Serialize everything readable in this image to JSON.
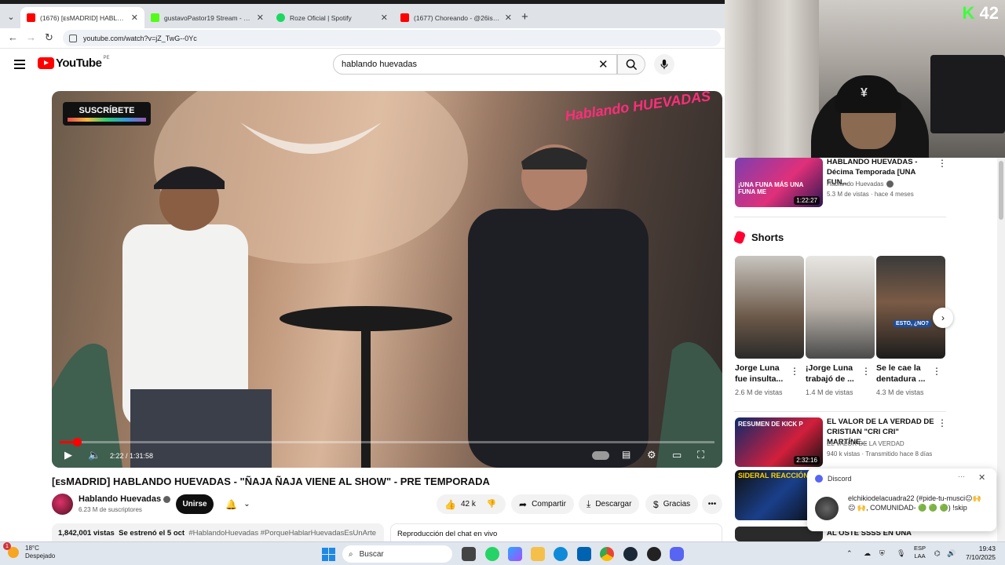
{
  "browser": {
    "tabs": [
      {
        "title": "(1676) [ᴇsMADRID] HABLANDO",
        "favicon_color": "#ff0000",
        "active": true
      },
      {
        "title": "gustavoPastor19 Stream - Watch",
        "favicon_color": "#53fc18",
        "active": false
      },
      {
        "title": "Roze Oficial | Spotify",
        "favicon_color": "#1ed760",
        "active": false
      },
      {
        "title": "(1677) Choreando - @26is , @",
        "favicon_color": "#ff0000",
        "active": false
      }
    ],
    "url": "youtube.com/watch?v=jZ_TwG--0Yc"
  },
  "youtube": {
    "logo_text": "YouTube",
    "country": "PE",
    "search_value": "hablando huevadas"
  },
  "video": {
    "badge_text": "SUSCRÍBETE",
    "show_logo": "Hablando HUEVADAS",
    "time": "2:22 / 1:31:58",
    "progress": 0.026,
    "title": "[ᴇsMADRID] HABLANDO HUEVADAS - \"ÑAJA ÑAJA VIENE AL SHOW\" - PRE TEMPORADA",
    "channel": "Hablando Huevadas",
    "subscribers": "6.23 M de suscriptores",
    "join_label": "Unirse",
    "likes": "42 k",
    "share_label": "Compartir",
    "download_label": "Descargar",
    "thanks_label": "Gracias",
    "views": "1,842,001 vistas",
    "premiered": "Se estrenó el 5 oct",
    "tags": "#HablandoHuevadas #PorqueHablarHuevadasEsUnArte",
    "chat_replay": "Reproducción del chat en vivo"
  },
  "webcam": {
    "overlay": "42"
  },
  "sidebar": {
    "top_video": {
      "title": "HABLANDO HUEVADAS - Décima Temporada [UNA FUN...",
      "channel": "Hablando Huevadas",
      "meta": "5.3 M de vistas · hace 4 meses",
      "duration": "1:22:27",
      "thumb_text": "¡UNA FUNA MÁS UNA FUNA ME"
    },
    "shorts_heading": "Shorts",
    "shorts": [
      {
        "title": "Jorge Luna fue insulta...",
        "views": "2.6 M de vistas"
      },
      {
        "title": "¡Jorge Luna trabajó de ...",
        "views": "1.4 M de vistas"
      },
      {
        "title": "Se le cae la dentadura ...",
        "views": "4.3 M de vistas",
        "thumb_text": "ESTO, ¿NO?"
      }
    ],
    "videos": [
      {
        "title": "EL VALOR DE LA VERDAD DE CRISTIAN \"CRI CRI\" MARTÍNE...",
        "channel": "EL VALOR DE LA VERDAD",
        "meta": "940 k vistas · Transmitido hace 8 días",
        "duration": "2:32:16",
        "thumb_text": "RESUMEN DE KICK P"
      },
      {
        "title": "",
        "channel": "",
        "meta": "",
        "thumb_text": "SIDERAL REACCIÓN"
      },
      {
        "title": "AL OSTE SSSS EN UNA",
        "channel": "",
        "meta": ""
      }
    ]
  },
  "toast": {
    "app": "Discord",
    "message": "elchikiodelacuadra22 (#pide-tu-musci😐🙌 😐 🙌, COMUNIDAD- 🟢 🟢 🟢) !skip"
  },
  "taskbar": {
    "temperature": "18°C",
    "weather": "Despejado",
    "notification_count": "1",
    "search_placeholder": "Buscar",
    "lang_top": "ESP",
    "lang_bottom": "LAA",
    "time": "19:43",
    "date": "7/10/2025"
  },
  "colors": {
    "yt_red": "#ff0000",
    "accent": "#065fd4"
  }
}
